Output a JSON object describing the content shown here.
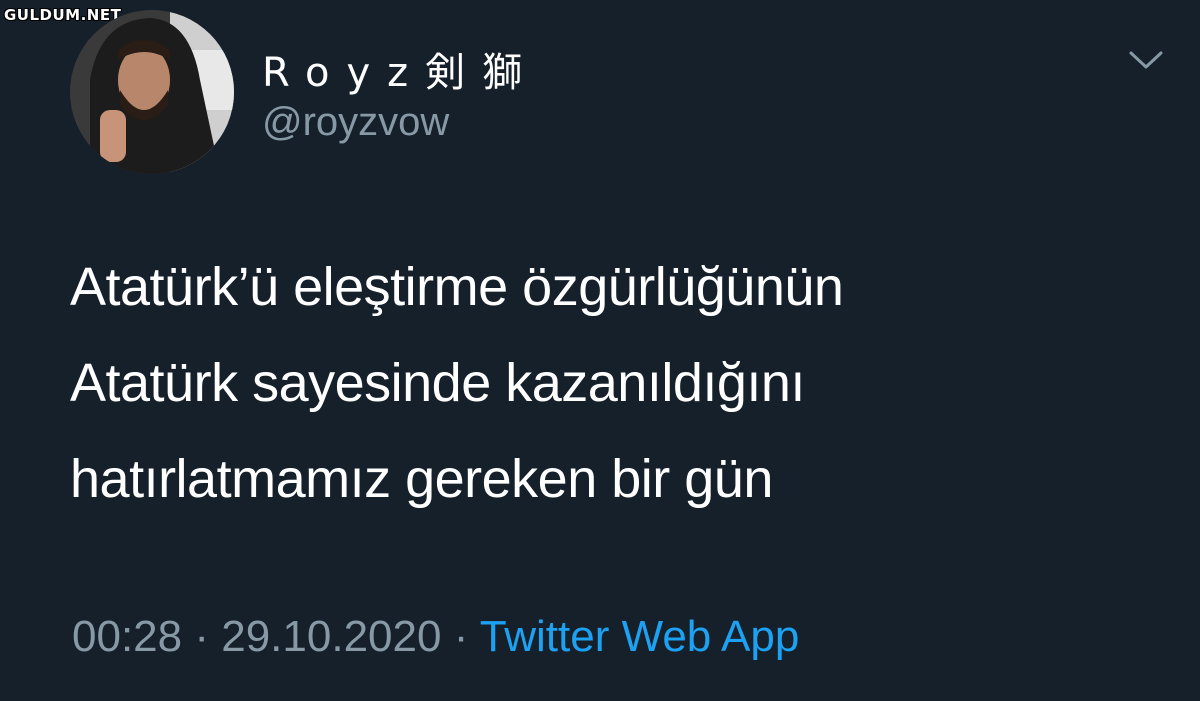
{
  "watermark": "GULDUM.NET",
  "user": {
    "display_name": "Royz剣獅",
    "handle": "@royzvow"
  },
  "tweet": {
    "lines": [
      "Atatürk’ü eleştirme özgürlüğünün",
      "Atatürk sayesinde kazanıldığını",
      "hatırlatmamız gereken bir gün"
    ],
    "time": "00:28",
    "separator": "·",
    "date": "29.10.2020",
    "source": "Twitter Web App"
  },
  "icons": {
    "menu": "chevron-down-icon",
    "avatar": "profile-photo"
  },
  "colors": {
    "background": "#15202b",
    "text_primary": "#ffffff",
    "text_secondary": "#8899a6",
    "link": "#1da1f2"
  }
}
